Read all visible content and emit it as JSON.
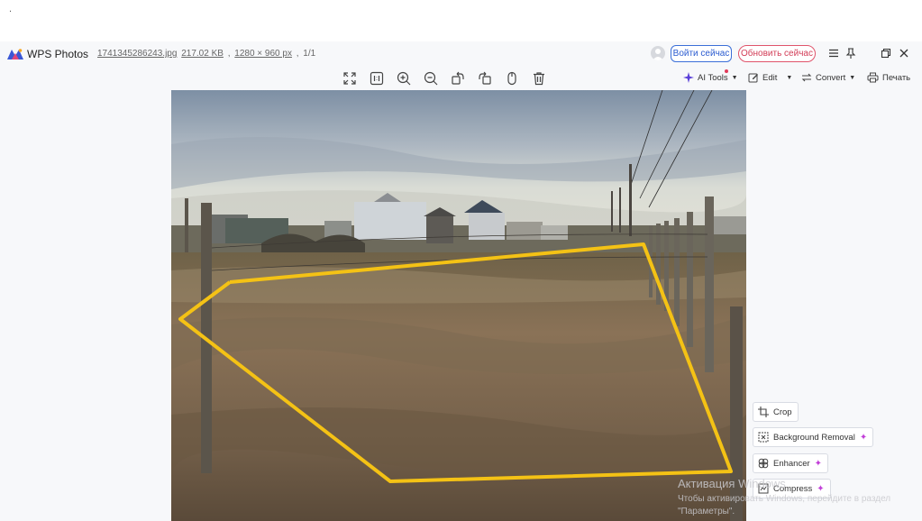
{
  "corner_mark": ".",
  "app": {
    "title": "WPS Photos",
    "logo_icon": "wps-photos-logo"
  },
  "file": {
    "name": "1741345286243.jpg",
    "size": "217.02 KB",
    "dimensions": "1280 × 960 px",
    "index": "1/1"
  },
  "account": {
    "login_label": "Войти сейчас",
    "update_label": "Обновить сейчас"
  },
  "window_controls": [
    "menu-icon",
    "pin-icon",
    "restore-icon",
    "close-icon"
  ],
  "toolbar": {
    "tools": [
      "fit-screen-icon",
      "actual-size-icon",
      "zoom-in-icon",
      "zoom-out-icon",
      "rotate-left-icon",
      "rotate-right-icon",
      "mouse-icon",
      "delete-icon"
    ],
    "ai_tools_label": "AI Tools",
    "edit_label": "Edit",
    "convert_label": "Convert",
    "print_label": "Печать"
  },
  "side_actions": {
    "crop": "Crop",
    "background_removal": "Background Removal",
    "enhancer": "Enhancer",
    "compress": "Compress",
    "spark": "✦"
  },
  "watermark": {
    "title": "Активация Windows",
    "text": "Чтобы активировать Windows, перейдите в раздел \"Параметры\"."
  },
  "colors": {
    "accent_blue": "#2a5bd0",
    "accent_red": "#d23c56",
    "outline_yellow": "#f4c215",
    "spark": "#c23fd8"
  }
}
